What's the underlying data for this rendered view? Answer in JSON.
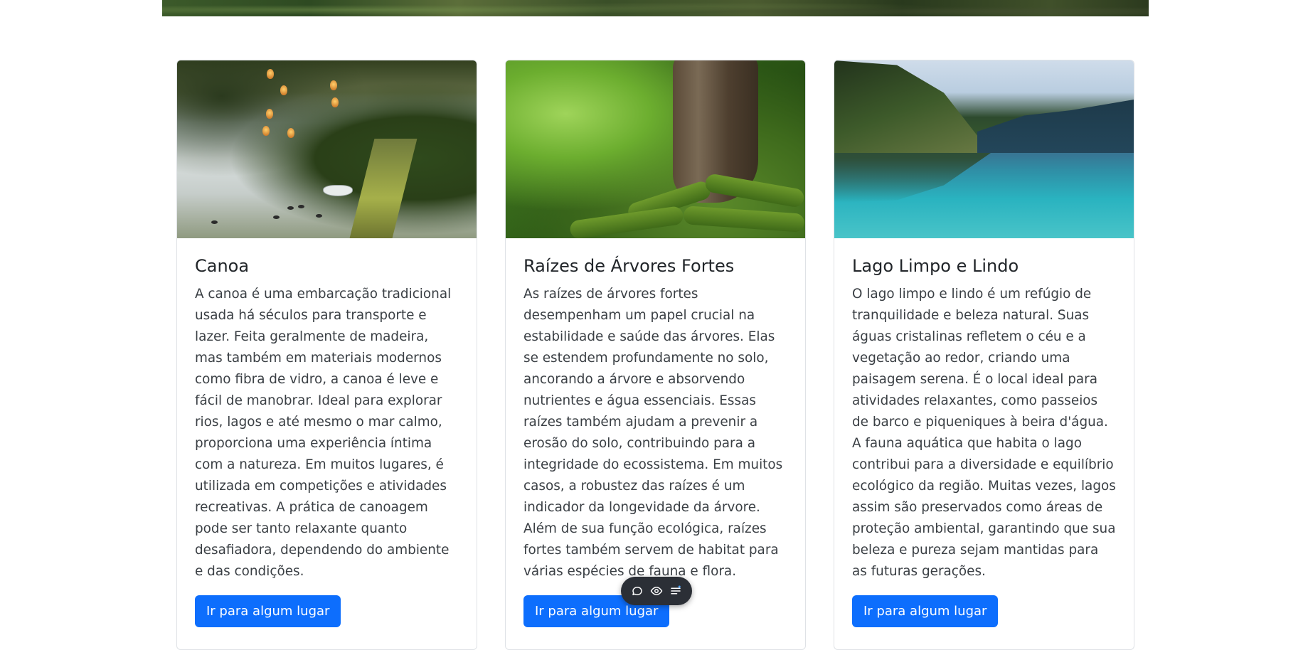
{
  "cards": [
    {
      "title": "Canoa",
      "text": "A canoa é uma embarcação tradicional usada há séculos para transporte e lazer. Feita geralmente de madeira, mas também em materiais modernos como fibra de vidro, a canoa é leve e fácil de manobrar. Ideal para explorar rios, lagos e até mesmo o mar calmo, proporciona uma experiência íntima com a natureza. Em muitos lugares, é utilizada em competições e atividades recreativas. A prática de canoagem pode ser tanto relaxante quanto desafiadora, dependendo do ambiente e das condições.",
      "button_label": "Ir para algum lugar"
    },
    {
      "title": "Raízes de Árvores Fortes",
      "text": "As raízes de árvores fortes desempenham um papel crucial na estabilidade e saúde das árvores. Elas se estendem profundamente no solo, ancorando a árvore e absorvendo nutrientes e água essenciais. Essas raízes também ajudam a prevenir a erosão do solo, contribuindo para a integridade do ecossistema. Em muitos casos, a robustez das raízes é um indicador da longevidade da árvore. Além de sua função ecológica, raízes fortes também servem de habitat para várias espécies de fauna e flora.",
      "button_label": "Ir para algum lugar"
    },
    {
      "title": "Lago Limpo e Lindo",
      "text": "O lago limpo e lindo é um refúgio de tranquilidade e beleza natural. Suas águas cristalinas refletem o céu e a vegetação ao redor, criando uma paisagem serena. É o local ideal para atividades relaxantes, como passeios de barco e piqueniques à beira d'água. A fauna aquática que habita o lago contribui para a diversidade e equilíbrio ecológico da região. Muitas vezes, lagos assim são preservados como áreas de proteção ambiental, garantindo que sua beleza e pureza sejam mantidas para as futuras gerações.",
      "button_label": "Ir para algum lugar"
    }
  ],
  "toolbar": {
    "icons": [
      "comment-icon",
      "eye-icon",
      "menu-icon"
    ]
  },
  "colors": {
    "primary": "#0d6efd",
    "toolbar_bg": "#2b2f36"
  }
}
